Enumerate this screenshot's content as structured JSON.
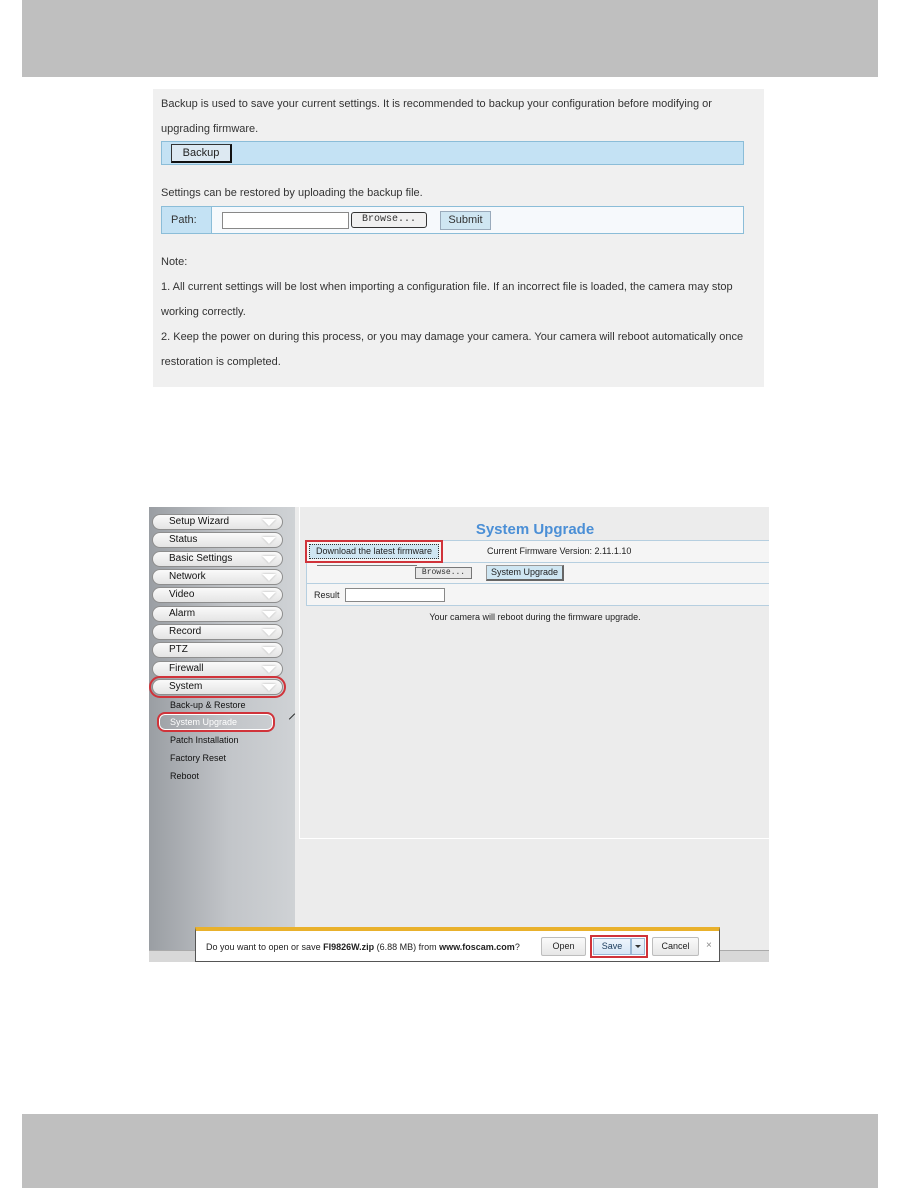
{
  "backup_restore": {
    "intro_line1": "Backup is used to save your current settings. It is recommended to backup your configuration before modifying or",
    "intro_line2": "upgrading firmware.",
    "backup_button": "Backup",
    "restore_text": "Settings can be restored by uploading the backup file.",
    "path_label": "Path:",
    "path_value": "",
    "browse_button": "Browse...",
    "submit_button": "Submit",
    "note_title": "Note:",
    "note1_line1": "1. All current settings will be lost when importing a configuration file. If an incorrect file is loaded, the camera may stop",
    "note1_line2": "working correctly.",
    "note2_line1": "2. Keep the power on during this process, or you may damage your camera. Your camera will reboot automatically once",
    "note2_line2": "restoration is completed."
  },
  "sidebar": {
    "menu": [
      {
        "label": "Setup Wizard"
      },
      {
        "label": "Status"
      },
      {
        "label": "Basic Settings"
      },
      {
        "label": "Network"
      },
      {
        "label": "Video"
      },
      {
        "label": "Alarm"
      },
      {
        "label": "Record"
      },
      {
        "label": "PTZ"
      },
      {
        "label": "Firewall"
      },
      {
        "label": "System",
        "active": true
      }
    ],
    "submenu": [
      {
        "label": "Back-up & Restore"
      },
      {
        "label": "System Upgrade",
        "selected": true
      },
      {
        "label": "Patch Installation"
      },
      {
        "label": "Factory Reset"
      },
      {
        "label": "Reboot"
      }
    ]
  },
  "upgrade": {
    "title": "System Upgrade",
    "download_button": "Download the latest firmware",
    "firmware_version_label": "Current Firmware Version: 2.11.1.10",
    "browse_button": "Browse...",
    "upgrade_button": "System Upgrade",
    "result_label": "Result",
    "result_value": "",
    "reboot_note": "Your camera will reboot during the firmware upgrade."
  },
  "download_bar": {
    "prefix": "Do you want to open or save ",
    "filename": "FI9826W.zip",
    "size": " (6.88 MB) from ",
    "site": "www.foscam.com",
    "suffix": "?",
    "open_button": "Open",
    "save_button": "Save",
    "cancel_button": "Cancel",
    "close_glyph": "×"
  },
  "colors": {
    "accent_title": "#4b8fd6",
    "highlight_outline": "#d0333a",
    "notification_bar": "#e9b12c",
    "panel_blue": "#c4e2f4"
  }
}
